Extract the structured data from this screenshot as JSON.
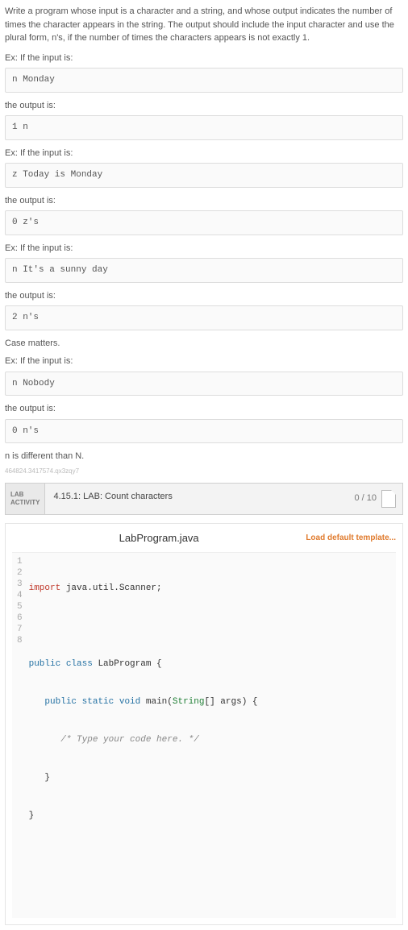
{
  "prompt": {
    "description": "Write a program whose input is a character and a string, and whose output indicates the number of times the character appears in the string. The output should include the input character and use the plural form, n's, if the number of times the characters appears is not exactly 1.",
    "examples": [
      {
        "intro": "Ex: If the input is:",
        "input": "n Monday",
        "output_label": "the output is:",
        "output": "1 n"
      },
      {
        "intro": "Ex: If the input is:",
        "input": "z Today is Monday",
        "output_label": "the output is:",
        "output": "0 z's"
      },
      {
        "intro": "Ex: If the input is:",
        "input": "n It's a sunny day",
        "output_label": "the output is:",
        "output": "2 n's"
      }
    ],
    "case_note": "Case matters.",
    "case_example": {
      "intro": "Ex: If the input is:",
      "input": "n Nobody",
      "output_label": "the output is:",
      "output": "0 n's"
    },
    "case_explain": "n is different than N.",
    "tiny_id": "464824.3417574.qx3zqy7"
  },
  "lab": {
    "badge_line1": "LAB",
    "badge_line2": "ACTIVITY",
    "title": "4.15.1: LAB: Count characters",
    "score": "0 / 10"
  },
  "editor": {
    "filename": "LabProgram.java",
    "load_template": "Load default template...",
    "lines": {
      "l1a": "import",
      "l1b": " java.util.Scanner;",
      "l3a": "public",
      "l3b": "class",
      "l3c": " LabProgram {",
      "l4a": "public",
      "l4b": "static",
      "l4c": "void",
      "l4d": " main(",
      "l4e": "String",
      "l4f": "[] args) {",
      "l5cm": "/* Type your code here. */",
      "l6": "   }",
      "l7": "}"
    }
  }
}
